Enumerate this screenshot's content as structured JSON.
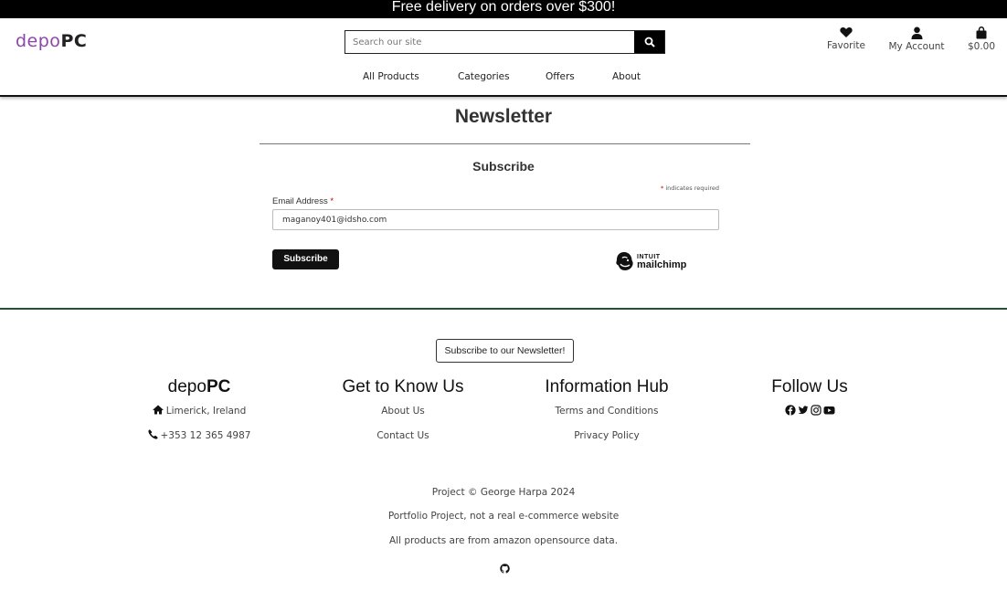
{
  "banner": {
    "text": "Free delivery on orders over $300!"
  },
  "header": {
    "logo_part1": "depo",
    "logo_part2": "PC",
    "search_placeholder": "Search our site",
    "favorite_label": "Favorite",
    "account_label": "My Account",
    "cart_total": "$0.00"
  },
  "nav": {
    "items": [
      "All Products",
      "Categories",
      "Offers",
      "About"
    ]
  },
  "main": {
    "title": "Newsletter",
    "subscribe_heading": "Subscribe",
    "required_note": "indicates required",
    "required_star": "*",
    "email_label": "Email Address",
    "email_value": "maganoy401@idsho.com",
    "subscribe_button": "Subscribe",
    "mailchimp_top": "INTUIT",
    "mailchimp_bottom": "mailchimp"
  },
  "footer": {
    "newsletter_button": "Subscribe to our Newsletter!",
    "col1": {
      "title_part1": "depo",
      "title_part2": "PC",
      "location": "Limerick, Ireland",
      "phone": "+353 12 365 4987"
    },
    "col2": {
      "title": "Get to Know Us",
      "links": [
        "About Us",
        "Contact Us"
      ]
    },
    "col3": {
      "title": "Information Hub",
      "links": [
        "Terms and Conditions",
        "Privacy Policy"
      ]
    },
    "col4": {
      "title": "Follow Us",
      "icons": [
        "facebook-icon",
        "twitter-icon",
        "instagram-icon",
        "youtube-icon"
      ]
    },
    "credits": [
      "Project © George Harpa 2024",
      "Portfolio Project, not a real e-commerce website",
      "All products are from amazon opensource data."
    ]
  },
  "colors": {
    "logo_accent": "#8e44ad",
    "footer_line": "#1e5631",
    "required": "#cc0000"
  }
}
